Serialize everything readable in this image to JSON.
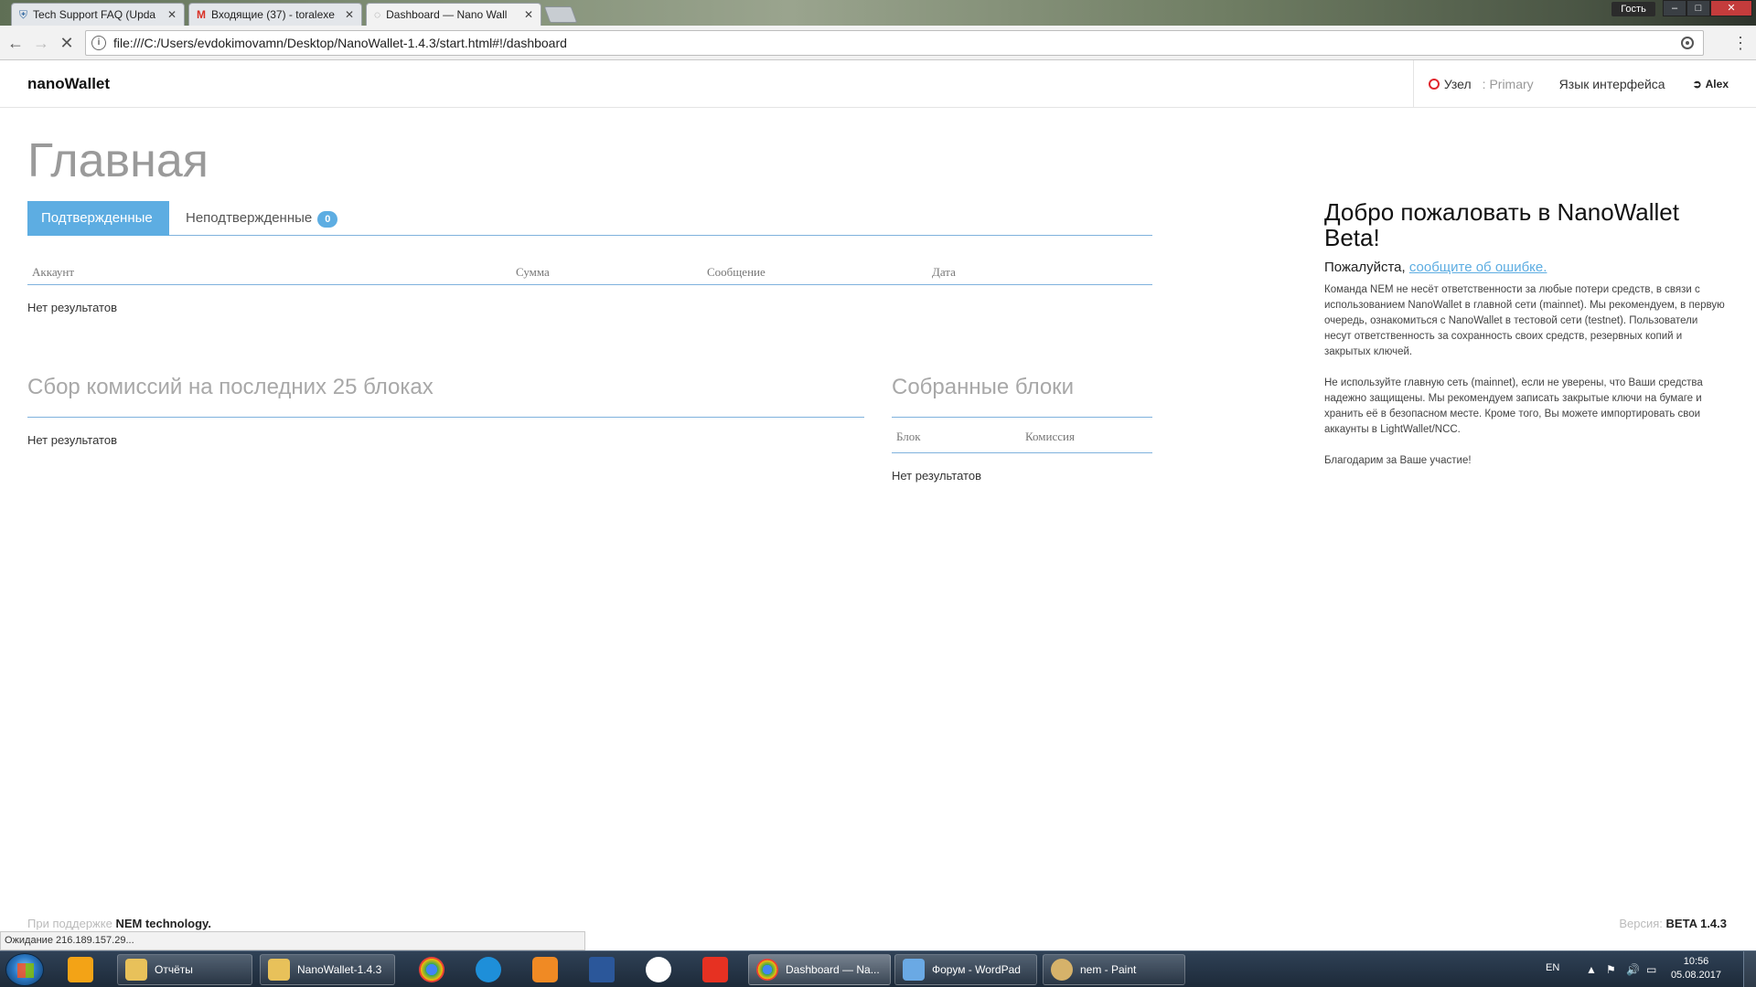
{
  "browser": {
    "tabs": [
      {
        "title": "Tech Support FAQ (Upda",
        "icon": "shield-icon"
      },
      {
        "title": "Входящие (37) - toralexe",
        "icon": "gmail-icon"
      },
      {
        "title": "Dashboard — Nano Wall",
        "icon": "loading-icon"
      }
    ],
    "guest_label": "Гость",
    "url": "file:///C:/Users/evdokimovamn/Desktop/NanoWallet-1.4.3/start.html#!/dashboard"
  },
  "app": {
    "brand": "nanoWallet",
    "node_label": "Узел",
    "node_name": ": Primary",
    "node_status_color": "#e0262d",
    "language_label": "Язык интерфейса",
    "account_label": "Alex"
  },
  "dashboard": {
    "title": "Главная",
    "tab_confirmed": "Подтвержденные",
    "tab_unconfirmed": "Неподтвержденные",
    "unconfirmed_count": "0",
    "tx_columns": [
      "Аккаунт",
      "Сумма",
      "Сообщение",
      "Дата"
    ],
    "no_results": "Нет результатов",
    "fees_title": "Сбор комиссий на последних 25 блоках",
    "harvested_title": "Собранные блоки",
    "harvested_columns": [
      "Блок",
      "Комиссия"
    ]
  },
  "welcome": {
    "title": "Добро пожаловать в NanoWallet Beta!",
    "please_prefix": "Пожалуйста, ",
    "report_link": "сообщите об ошибке.",
    "p1": "Команда NEM не несёт ответственности за любые потери средств, в связи с использованием NanoWallet в главной сети (mainnet). Мы рекомендуем, в первую очередь, ознакомиться с NanoWallet в тестовой сети (testnet). Пользователи несут ответственность за сохранность своих средств, резервных копий и закрытых ключей.",
    "p2": "Не используйте главную сеть (mainnet), если не уверены, что Ваши средства надежно защищены. Мы рекомендуем записать закрытые ключи на бумаге и хранить её в безопасном месте. Кроме того, Вы можете импортировать свои аккаунты в LightWallet/NCC.",
    "p3": "Благодарим за Ваше участие!"
  },
  "footer": {
    "powered_prefix": "При поддержке",
    "powered_by": "NEM technology.",
    "version_label": "Версия:",
    "version": "BETA 1.4.3",
    "status": "Ожидание 216.189.157.29..."
  },
  "taskbar": {
    "items": [
      {
        "label": "Отчёты",
        "icon": "folder-icon"
      },
      {
        "label": "NanoWallet-1.4.3",
        "icon": "folder-icon"
      },
      {
        "label": "Dashboard — Na...",
        "icon": "chrome-icon"
      },
      {
        "label": "Форум - WordPad",
        "icon": "wordpad-icon"
      },
      {
        "label": "nem - Paint",
        "icon": "paint-icon"
      }
    ],
    "lang": "EN",
    "time": "10:56",
    "date": "05.08.2017"
  }
}
